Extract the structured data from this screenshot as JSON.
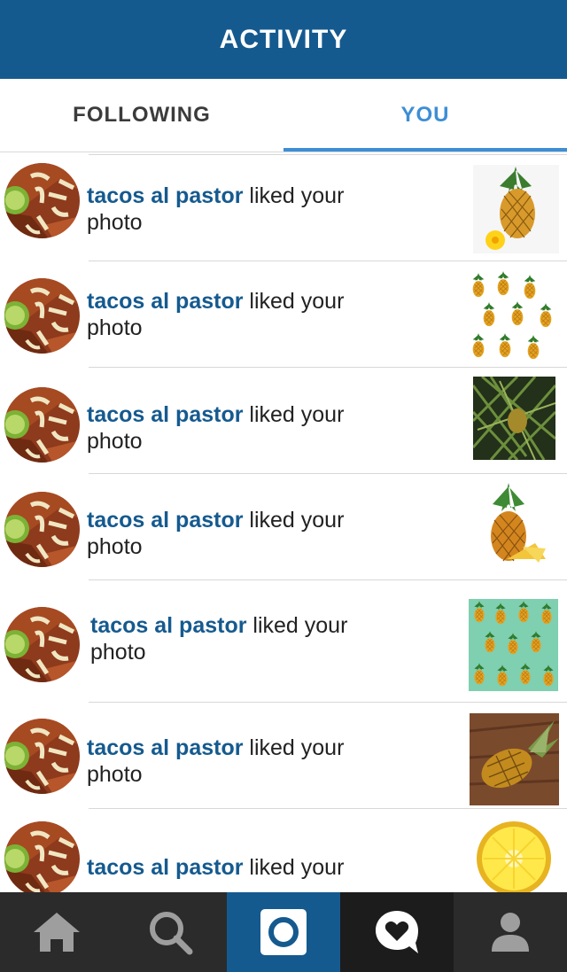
{
  "header": {
    "title": "ACTIVITY"
  },
  "tabs": {
    "following": "FOLLOWING",
    "you": "YOU"
  },
  "colors": {
    "brand": "#155a8f",
    "accent": "#3e8ed5",
    "tabbar": "#2b2b2b"
  },
  "feed": {
    "items": [
      {
        "user": "tacos al pastor",
        "action_line1": " liked your",
        "action_line2": "photo",
        "thumb": "pineapple-with-flower"
      },
      {
        "user": "tacos al pastor",
        "action_line1": " liked your",
        "action_line2": "photo",
        "thumb": "pineapple-pattern-white"
      },
      {
        "user": "tacos al pastor",
        "action_line1": " liked your",
        "action_line2": "photo",
        "thumb": "pineapple-plant"
      },
      {
        "user": "tacos al pastor",
        "action_line1": " liked your",
        "action_line2": "photo",
        "thumb": "pineapple-sliced"
      },
      {
        "user": "tacos al pastor",
        "action_line1": " liked your",
        "action_line2": "photo",
        "thumb": "pineapple-pattern-teal"
      },
      {
        "user": "tacos al pastor",
        "action_line1": " liked your",
        "action_line2": "photo",
        "thumb": "pineapple-on-wood"
      },
      {
        "user": "tacos al pastor",
        "action_line1": " liked your",
        "action_line2": "",
        "thumb": "pineapple-cross-section"
      }
    ]
  },
  "tabbar": {
    "items": [
      {
        "icon": "home-icon"
      },
      {
        "icon": "search-icon"
      },
      {
        "icon": "camera-icon"
      },
      {
        "icon": "activity-heart-icon"
      },
      {
        "icon": "profile-icon"
      }
    ]
  }
}
